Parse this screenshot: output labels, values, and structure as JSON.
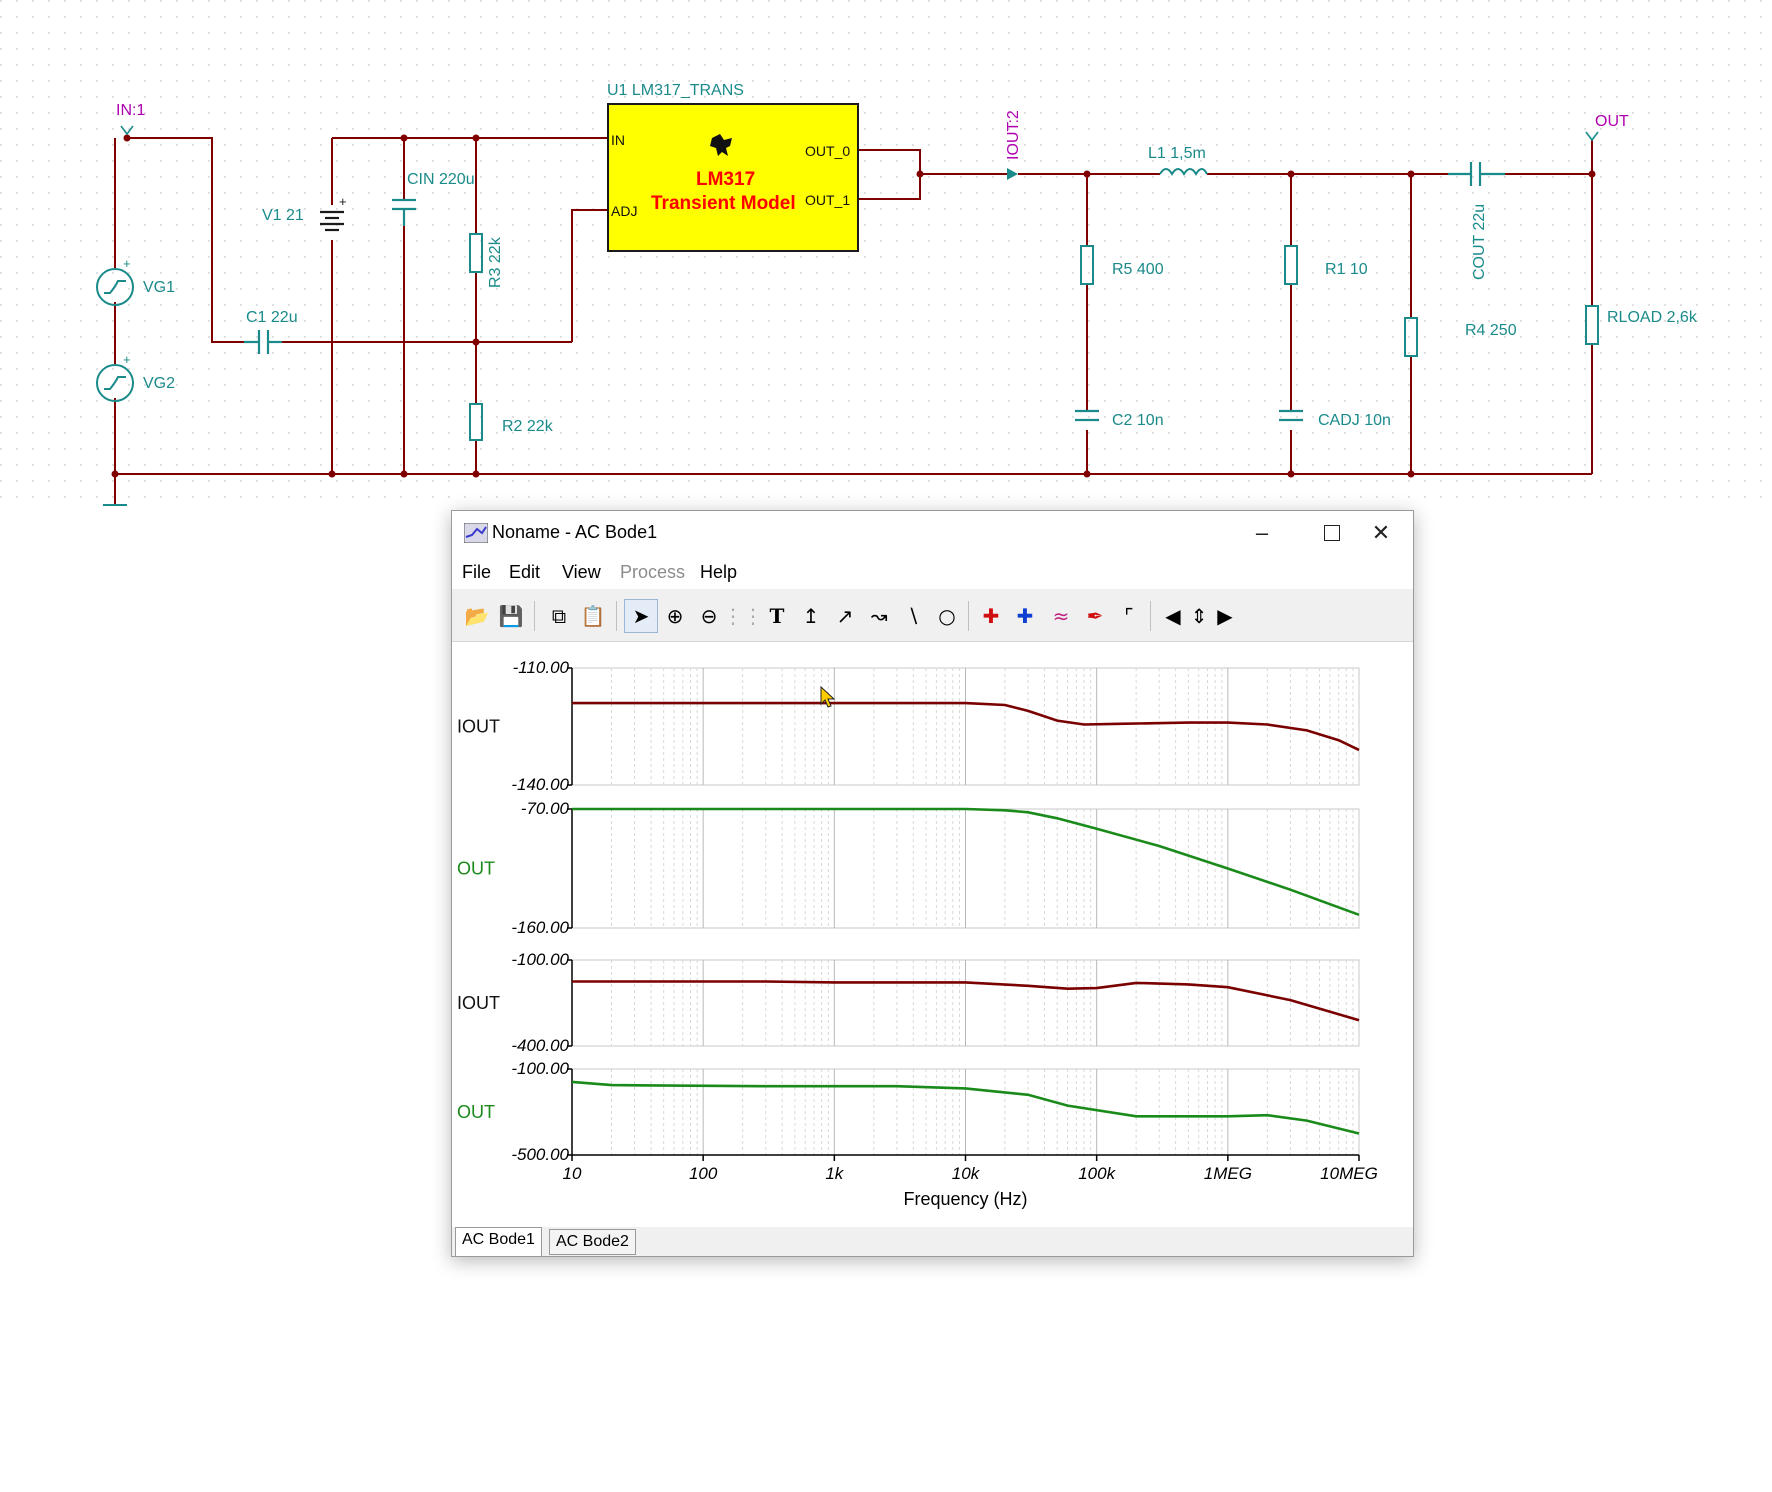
{
  "schematic": {
    "labels": {
      "in_node": "IN:1",
      "u1": "U1 LM317_TRANS",
      "ic_pin_in": "IN",
      "ic_pin_adj": "ADJ",
      "ic_pin_out0": "OUT_0",
      "ic_pin_out1": "OUT_1",
      "ic_name": "LM317",
      "ic_model": "Transient Model",
      "iout_probe": "IOUT:2",
      "out_node": "OUT",
      "v1": "V1 21",
      "cin": "CIN 220u",
      "r3": "R3 22k",
      "vg1": "VG1",
      "vg2": "VG2",
      "c1": "C1 22u",
      "r2": "R2 22k",
      "l1": "L1 1,5m",
      "r5": "R5 400",
      "r1": "R1 10",
      "cout": "COUT 22u",
      "r4": "R4 250",
      "rload": "RLOAD 2,6k",
      "c2": "C2 10n",
      "cadj": "CADJ 10n"
    },
    "colors": {
      "wire": "#800000",
      "component": "#1a8a8a",
      "label_component": "#1a8a8a",
      "label_node": "#b000b0",
      "ic_fill": "#ffff00",
      "ic_text": "#ff0000"
    }
  },
  "window": {
    "title": "Noname - AC Bode1",
    "menu": [
      "File",
      "Edit",
      "View",
      "Process",
      "Help"
    ],
    "menu_disabled": [
      "Process"
    ],
    "toolbar_icons": [
      "open-icon",
      "save-icon",
      "copy-icon",
      "paste-icon",
      "pointer-icon",
      "zoom-in-icon",
      "zoom-out-100-icon",
      "grid-icon",
      "text-icon",
      "line-tool-1-icon",
      "line-tool-2-icon",
      "line-tool-3-icon",
      "line-icon",
      "circle-icon",
      "cursor-a-icon",
      "cursor-b-icon",
      "curves-icon",
      "probe-icon",
      "step-icon",
      "arrow-left-icon",
      "arrow-updown-icon",
      "arrow-right-icon"
    ],
    "tabs": [
      "AC Bode1",
      "AC Bode2"
    ],
    "active_tab": "AC Bode1"
  },
  "chart_data": {
    "type": "line",
    "xlabel": "Frequency (Hz)",
    "xscale": "log",
    "xlim": [
      10,
      10000000
    ],
    "x_tick_labels": [
      "10",
      "100",
      "1k",
      "10k",
      "100k",
      "1MEG",
      "10MEG"
    ],
    "x_tick_values": [
      10,
      100,
      1000,
      10000,
      100000,
      1000000,
      10000000
    ],
    "panels": [
      {
        "name": "IOUT",
        "color": "#7a0000",
        "ylim": [
          -140,
          -110
        ],
        "y_tick_labels": [
          "-110.00",
          "-140.00"
        ],
        "x": [
          10,
          1000,
          10000,
          20000,
          30000,
          50000,
          80000,
          150000,
          500000,
          1000000,
          2000000,
          4000000,
          7000000,
          10000000
        ],
        "values": [
          -119,
          -119,
          -119,
          -119.5,
          -121,
          -123.5,
          -124.5,
          -124.3,
          -124,
          -124,
          -124.5,
          -126,
          -128.5,
          -131
        ]
      },
      {
        "name": "OUT",
        "color": "#1a8a1a",
        "ylim": [
          -160,
          -70
        ],
        "y_tick_labels": [
          "-70.00",
          "-160.00"
        ],
        "x": [
          10,
          10000,
          20000,
          30000,
          50000,
          100000,
          300000,
          1000000,
          3000000,
          10000000
        ],
        "values": [
          -70,
          -70,
          -71,
          -72.5,
          -77,
          -85,
          -98,
          -115,
          -131,
          -150
        ]
      },
      {
        "name": "IOUT",
        "color": "#7a0000",
        "ylim": [
          -400,
          -100
        ],
        "y_tick_labels": [
          "-100.00",
          "-400.00"
        ],
        "x": [
          10,
          300,
          1000,
          10000,
          30000,
          60000,
          100000,
          200000,
          500000,
          1000000,
          3000000,
          10000000
        ],
        "values": [
          -175,
          -175,
          -178,
          -178,
          -190,
          -200,
          -198,
          -180,
          -185,
          -195,
          -240,
          -310
        ]
      },
      {
        "name": "OUT",
        "color": "#1a8a1a",
        "ylim": [
          -500,
          -100
        ],
        "y_tick_labels": [
          "-100.00",
          "-500.00"
        ],
        "x": [
          10,
          20,
          300,
          3000,
          10000,
          30000,
          60000,
          200000,
          500000,
          1000000,
          2000000,
          4000000,
          10000000
        ],
        "values": [
          -160,
          -175,
          -180,
          -180,
          -190,
          -220,
          -270,
          -320,
          -320,
          -320,
          -315,
          -340,
          -400
        ]
      }
    ]
  }
}
